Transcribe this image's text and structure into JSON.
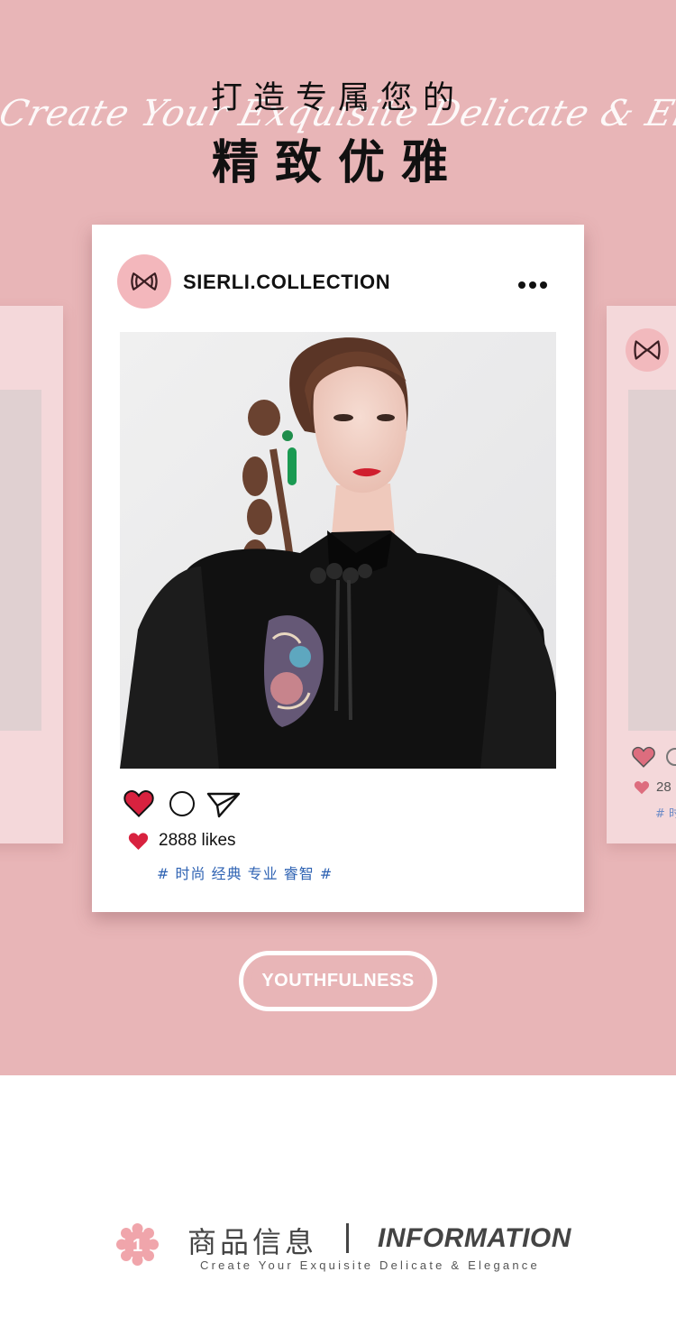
{
  "hero": {
    "script_text": "Create Your Exquisite Delicate & Elegance",
    "headline_line1": "打造专属您的",
    "headline_line2": "精致优雅"
  },
  "post": {
    "handle": "SIERLI.COLLECTION",
    "likes_text": "2888 likes",
    "tags_text": "# 时尚 经典 专业 睿智 #"
  },
  "side_card": {
    "likes_count": "28",
    "tag_fragment": "# 时"
  },
  "button": {
    "label": "YOUTHFULNESS"
  },
  "info": {
    "badge_number": "1",
    "title_cn": "商品信息",
    "title_en": "INFORMATION",
    "subtitle": "Create Your Exquisite Delicate & Elegance"
  },
  "colors": {
    "hero_bg": "#e8b5b7",
    "heart_red": "#d8223f",
    "tag_blue": "#2f63b3",
    "avatar_pink": "#f3b7bc"
  },
  "icons": [
    "more-dots-icon",
    "heart-icon",
    "comment-icon",
    "share-icon",
    "flower-badge-icon",
    "brand-logo-icon"
  ]
}
